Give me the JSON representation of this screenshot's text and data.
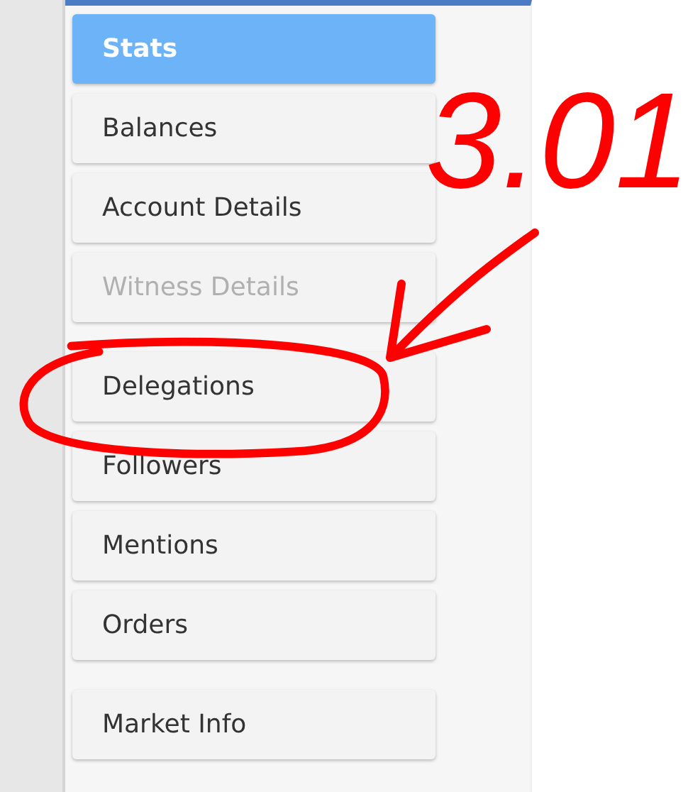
{
  "menu_groups": [
    {
      "items": [
        {
          "label": "Stats",
          "selected": true,
          "disabled": false
        },
        {
          "label": "Balances",
          "selected": false,
          "disabled": false
        },
        {
          "label": "Account Details",
          "selected": false,
          "disabled": false
        },
        {
          "label": "Witness Details",
          "selected": false,
          "disabled": true
        }
      ]
    },
    {
      "items": [
        {
          "label": "Delegations",
          "selected": false,
          "disabled": false
        },
        {
          "label": "Followers",
          "selected": false,
          "disabled": false
        },
        {
          "label": "Mentions",
          "selected": false,
          "disabled": false
        },
        {
          "label": "Orders",
          "selected": false,
          "disabled": false
        }
      ]
    },
    {
      "items": [
        {
          "label": "Market Info",
          "selected": false,
          "disabled": false
        }
      ]
    }
  ],
  "annotation": {
    "text": "3.01",
    "color": "#ff0000"
  }
}
